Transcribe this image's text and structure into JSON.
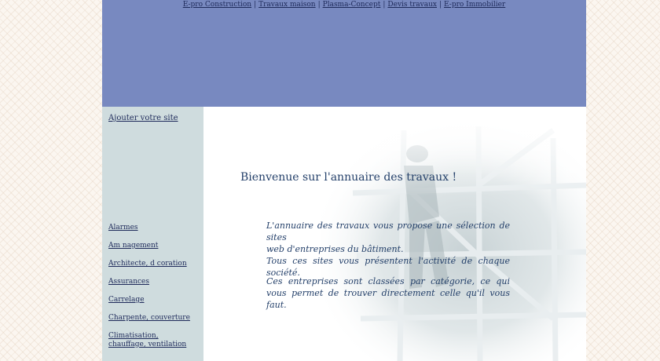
{
  "top_nav": {
    "links": [
      "E-pro Construction",
      "Travaux maison",
      "Plasma-Concept",
      "Devis travaux",
      "E-pro Immobilier"
    ],
    "separator": "|"
  },
  "sidebar": {
    "add_site": "Ajouter votre site",
    "categories": [
      "Alarmes",
      "Am nagement",
      "Architecte, d coration",
      "Assurances",
      "Carrelage",
      "Charpente, couverture",
      "Climatisation, chauffage, ventilation"
    ]
  },
  "main": {
    "welcome": "Bienvenue sur l'annuaire des travaux !",
    "paragraph1_lines": [
      "L'annuaire des travaux vous propose une sélection de sites",
      "web d'entreprises du bâtiment.",
      "Tous ces sites vous présentent l'activité de chaque société."
    ],
    "paragraph2": "Ces entreprises sont classées par catégorie, ce qui vous permet de trouver directement celle qu'il vous faut."
  },
  "colors": {
    "header": "#7889c0",
    "sidebar": "#cfdcde",
    "text": "#24406a",
    "link": "#1e2a5a"
  }
}
